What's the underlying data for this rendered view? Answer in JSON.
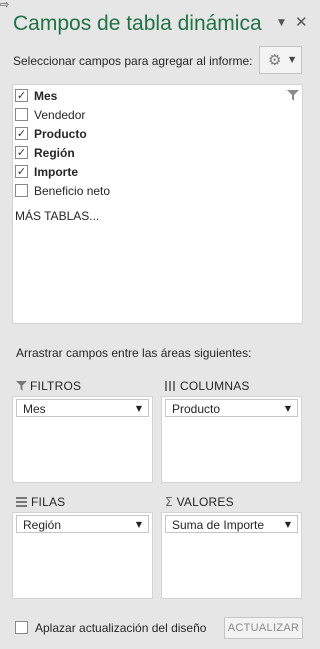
{
  "pane": {
    "title": "Campos de tabla dinámica",
    "choose_label": "Seleccionar campos para agregar al informe:",
    "resize_icon": "resize-arrows-icon",
    "dropdown_icon": "chevron-down-icon",
    "close_icon": "close-icon",
    "tools_icon": "gear-icon"
  },
  "fields": [
    {
      "label": "Mes",
      "checked": true,
      "bold": true
    },
    {
      "label": "Vendedor",
      "checked": false,
      "bold": false
    },
    {
      "label": "Producto",
      "checked": true,
      "bold": true
    },
    {
      "label": "Región",
      "checked": true,
      "bold": true
    },
    {
      "label": "Importe",
      "checked": true,
      "bold": true
    },
    {
      "label": "Beneficio neto",
      "checked": false,
      "bold": false
    }
  ],
  "more_tables": "MÁS TABLAS...",
  "drag_label": "Arrastrar campos entre las áreas siguientes:",
  "areas": {
    "filters": {
      "label": "FILTROS",
      "icon": "filter-icon",
      "value": "Mes"
    },
    "columns": {
      "label": "COLUMNAS",
      "icon": "columns-icon",
      "value": "Producto"
    },
    "rows": {
      "label": "FILAS",
      "icon": "rows-icon",
      "value": "Región"
    },
    "values": {
      "label": "VALORES",
      "icon": "sigma-icon",
      "value": "Suma de Importe"
    }
  },
  "footer": {
    "defer_label": "Aplazar actualización del diseño",
    "defer_checked": false,
    "update_label": "ACTUALIZAR"
  },
  "colors": {
    "title": "#217346",
    "pane_background": "#e6e6e6",
    "list_background": "#ffffff"
  }
}
